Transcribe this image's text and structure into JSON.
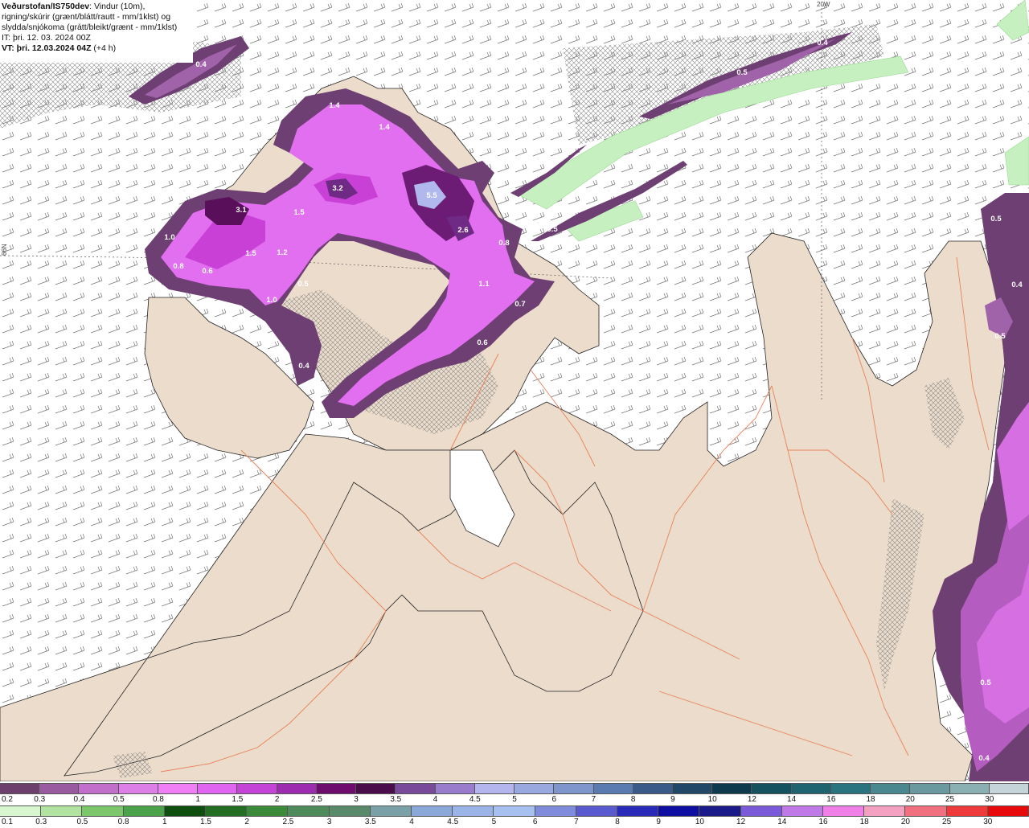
{
  "header": {
    "source": "Veðurstofan/IS750dev",
    "desc_line1": ": Vindur (10m),",
    "desc_line2": "rigning/skúrir (grænt/blátt/rautt - mm/1klst) og",
    "desc_line3": "slydda/snjókoma (grátt/bleikt/grænt - mm/1klst)",
    "it_label": "IT:",
    "it_value": " þri. 12. 03. 2024 00Z",
    "vt_label": "VT:",
    "vt_value": " þri. 12.03.2024 04Z",
    "vt_offset": " (+4 h)"
  },
  "grid_labels": {
    "lon": "20W",
    "lat": "66N"
  },
  "precip_labels": [
    "0.4",
    "0.4",
    "0.5",
    "1.4",
    "1.4",
    "3.2",
    "5.5",
    "3.1",
    "1.5",
    "2.6",
    "0.8",
    "1.0",
    "1.5",
    "1.2",
    "0.8",
    "0.6",
    "0.5",
    "1.0",
    "1.1",
    "0.7",
    "0.6",
    "0.4",
    "0.5",
    "0.5",
    "0.4",
    "0.5",
    "0.5",
    "0.4"
  ],
  "colorbar_top": {
    "ticks": [
      "0.2",
      "0.3",
      "0.4",
      "0.5",
      "0.8",
      "1",
      "1.5",
      "2",
      "2.5",
      "3",
      "3.5",
      "4",
      "4.5",
      "5",
      "6",
      "7",
      "8",
      "9",
      "10",
      "12",
      "14",
      "16",
      "18",
      "20",
      "25",
      "30"
    ],
    "colors": [
      "#6d3f6d",
      "#9a5aa0",
      "#c16fcb",
      "#dc7fe6",
      "#f07ff5",
      "#e065f0",
      "#c544d8",
      "#9d2cb0",
      "#6e0d6e",
      "#4a0c4a",
      "#7a4a9a",
      "#9a7ccc",
      "#b4b4ee",
      "#9aa8e0",
      "#7f96cc",
      "#5a7ab2",
      "#3a5a8a",
      "#214866",
      "#0e3a4e",
      "#155260",
      "#1d6470",
      "#2a7480",
      "#4a8890",
      "#6a9aa0",
      "#8ab0b4",
      "#c4d4d8"
    ]
  },
  "colorbar_bottom": {
    "ticks": [
      "0.1",
      "0.3",
      "0.5",
      "0.8",
      "1",
      "1.5",
      "2",
      "2.5",
      "3",
      "3.5",
      "4",
      "4.5",
      "5",
      "6",
      "7",
      "8",
      "9",
      "10",
      "12",
      "14",
      "16",
      "18",
      "20",
      "25",
      "30"
    ],
    "colors": [
      "#d8f6d0",
      "#b0e4a0",
      "#7cc66c",
      "#4aa24a",
      "#0e4e0e",
      "#236e23",
      "#3a8a3a",
      "#4f8a5a",
      "#5a8a6a",
      "#7aa0a8",
      "#8aa8d8",
      "#9ab4e8",
      "#a6c0f0",
      "#7f8cdc",
      "#5a5ad0",
      "#2a2ab8",
      "#0e0ea0",
      "#1a1a88",
      "#7a5ad8",
      "#c07ae8",
      "#f080e8",
      "#f4a0c0",
      "#f07080",
      "#ee3a3a",
      "#e80a0a"
    ]
  }
}
